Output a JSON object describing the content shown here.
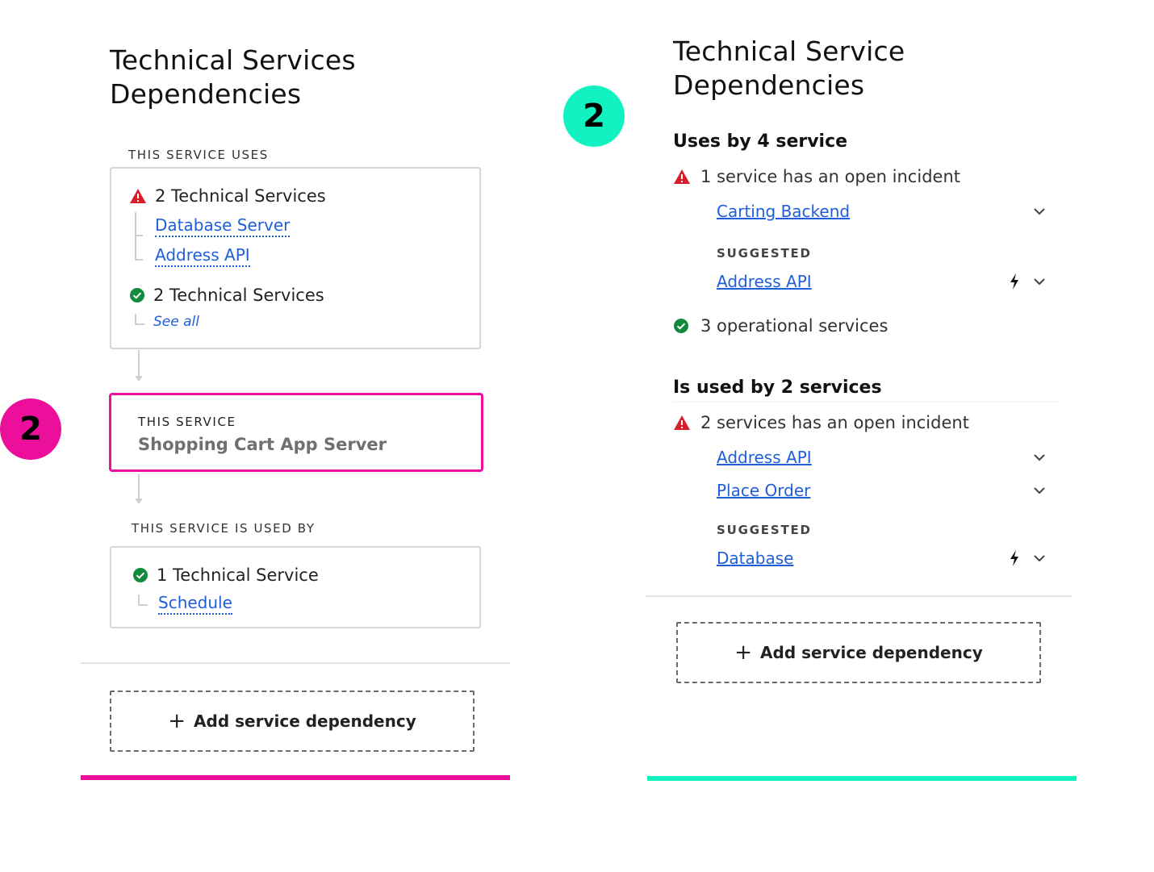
{
  "colors": {
    "link": "#1f5ed8",
    "magenta": "#ec0f9c",
    "mint": "#12f2c1",
    "danger": "#d81d2c",
    "success": "#128a3e"
  },
  "left": {
    "badge": "2",
    "title_line1": "Technical Services",
    "title_line2": "Dependencies",
    "uses_label": "THIS SERVICE USES",
    "uses_box": {
      "group1_label": "2 Technical Services",
      "group1_icon": "warning-icon",
      "group1_links": [
        "Database Server",
        "Address API"
      ],
      "group2_label": "2 Technical Services",
      "group2_icon": "check-circle-icon",
      "group2_link": "See all"
    },
    "current": {
      "label": "THIS SERVICE",
      "name": "Shopping Cart App Server"
    },
    "used_by_label": "THIS SERVICE IS USED BY",
    "used_by_box": {
      "label": "1 Technical Service",
      "icon": "check-circle-icon",
      "link": "Schedule"
    },
    "add_button": "Add service dependency"
  },
  "right": {
    "badge": "2",
    "title_line1": "Technical Service",
    "title_line2": "Dependencies",
    "uses": {
      "heading": "Uses by 4 service",
      "incident_text": "1 service has an open incident",
      "incident_items": [
        "Carting Backend"
      ],
      "suggested_label": "SUGGESTED",
      "suggested_items": [
        "Address API"
      ],
      "operational_text": "3 operational services"
    },
    "used_by": {
      "heading": "Is used by 2 services",
      "incident_text": "2 services has an open incident",
      "incident_items": [
        "Address API",
        "Place Order"
      ],
      "suggested_label": "SUGGESTED",
      "suggested_items": [
        "Database"
      ]
    },
    "add_button": "Add service dependency"
  }
}
